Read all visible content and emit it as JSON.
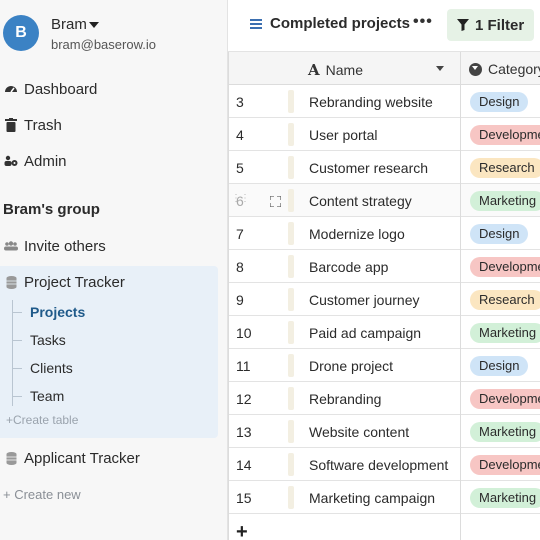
{
  "user": {
    "initial": "B",
    "name": "Bram",
    "email": "bram@baserow.io"
  },
  "nav": {
    "dashboard": "Dashboard",
    "trash": "Trash",
    "admin": "Admin"
  },
  "group": {
    "title": "Bram's group",
    "invite": "Invite others",
    "databases": [
      {
        "name": "Project Tracker",
        "tables": [
          "Projects",
          "Tasks",
          "Clients",
          "Team"
        ],
        "active_table": "Projects",
        "create_table": "Create table"
      },
      {
        "name": "Applicant Tracker"
      }
    ],
    "create_new": "Create new"
  },
  "header": {
    "view_name": "Completed projects",
    "more": "•••",
    "filter_label": "1 Filter"
  },
  "grid": {
    "columns": {
      "name": "Name",
      "category": "Category"
    },
    "rows": [
      {
        "id": "3",
        "name": "Rebranding website",
        "category": "Design"
      },
      {
        "id": "4",
        "name": "User portal",
        "category": "Development"
      },
      {
        "id": "5",
        "name": "Customer research",
        "category": "Research"
      },
      {
        "id": "6",
        "name": "Content strategy",
        "category": "Marketing"
      },
      {
        "id": "7",
        "name": "Modernize logo",
        "category": "Design"
      },
      {
        "id": "8",
        "name": "Barcode app",
        "category": "Development"
      },
      {
        "id": "9",
        "name": "Customer journey",
        "category": "Research"
      },
      {
        "id": "10",
        "name": "Paid ad campaign",
        "category": "Marketing"
      },
      {
        "id": "11",
        "name": "Drone project",
        "category": "Design"
      },
      {
        "id": "12",
        "name": "Rebranding",
        "category": "Development"
      },
      {
        "id": "13",
        "name": "Website content",
        "category": "Marketing"
      },
      {
        "id": "14",
        "name": "Software development",
        "category": "Development"
      },
      {
        "id": "15",
        "name": "Marketing campaign",
        "category": "Marketing"
      }
    ],
    "add_row": "+"
  },
  "colors": {
    "Design": "#cfe4f7",
    "Development": "#f7c6c4",
    "Research": "#fbe6c1",
    "Marketing": "#d2f0d8",
    "accent": "#3b82c4",
    "filter_bg": "#e6f2e6"
  }
}
